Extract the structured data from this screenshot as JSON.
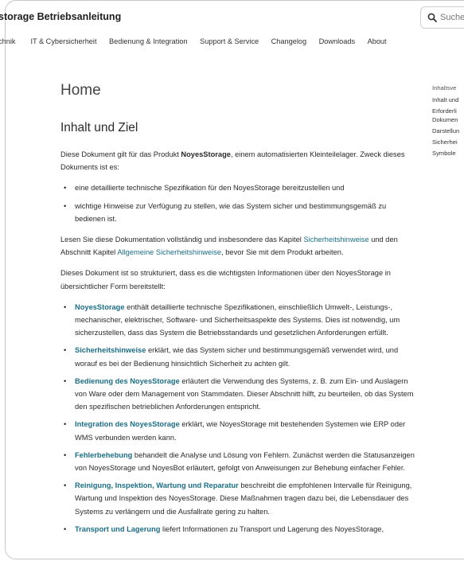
{
  "header": {
    "title": "storage Betriebsanleitung",
    "search_placeholder": "Suche"
  },
  "nav": [
    "chnik",
    "IT & Cybersicherheit",
    "Bedienung & Integration",
    "Support & Service",
    "Changelog",
    "Downloads",
    "About"
  ],
  "page": {
    "title": "Home",
    "section_heading": "Inhalt und Ziel",
    "intro_1": "Diese Dokument gilt für das Produkt ",
    "product": "NoyesStorage",
    "intro_2": ", einem automatisierten Kleinteilelager. Zweck dieses Dokuments ist es:",
    "goals": [
      "eine detaillierte technische Spezifikation für den NoyesStorage bereitzustellen und",
      "wichtige Hinweise zur Verfügung zu stellen, wie das System sicher und bestimmungsgemäß zu bedienen ist."
    ],
    "read_1": "Lesen Sie diese Dokumentation vollständig und insbesondere das Kapitel ",
    "read_link_1": "Sicherheitshinweise",
    "read_2": " und den Abschnitt Kapitel ",
    "read_link_2": "Allgemeine Sicherheitshinweise",
    "read_3": ", bevor Sie mit dem Produkt arbeiten.",
    "structure": "Dieses Dokument ist so strukturiert, dass es die wichtigsten Informationen über den NoyesStorage in übersichtlicher Form bereitstellt:",
    "chapters": [
      {
        "lead": "NoyesStorage",
        "text": " enthält detaillierte technische Spezifikationen, einschließlich Umwelt-, Leistungs-, mechanischer, elektrischer, Software- und Sicherheitsaspekte des Systems. Dies ist notwendig, um sicherzustellen, dass das System die Betriebsstandards und gesetzlichen Anforderungen erfüllt."
      },
      {
        "lead": "Sicherheitshinweise",
        "text": " erklärt, wie das System sicher und bestimmungsgemäß verwendet wird, und worauf es bei der Bedienung hinsichtlich Sicherheit zu achten gilt."
      },
      {
        "lead": "Bedienung des NoyesStorage",
        "text": " erläutert die Verwendung des Systems, z. B. zum Ein- und Auslagern von Ware oder dem Management von Stammdaten. Dieser Abschnitt hilft, zu beurteilen, ob das System den spezifischen betrieblichen Anforderungen entspricht."
      },
      {
        "lead": "Integration des NoyesStorage",
        "text": " erklärt, wie NoyesStorage mit bestehenden Systemen wie ERP oder WMS verbunden werden kann."
      },
      {
        "lead": "Fehlerbehebung",
        "text": " behandelt die Analyse und Lösung von Fehlern. Zunächst werden die Statusanzeigen von NoyesStorage und NoyesBot erläutert, gefolgt von Anweisungen zur Behebung einfacher Fehler."
      },
      {
        "lead": "Reinigung, Inspektion, Wartung und Reparatur",
        "text": " beschreibt die empfohlenen Intervalle für Reinigung, Wartung und Inspektion des NoyesStorage. Diese Maßnahmen tragen dazu bei, die Lebensdauer des Systems zu verlängern und die Ausfallrate gering zu halten."
      },
      {
        "lead": "Transport und Lagerung",
        "text": " liefert Informationen zu Transport und Lagerung des NoyesStorage,"
      }
    ]
  },
  "toc": {
    "heading": "Inhaltsve",
    "items": [
      "Inhalt und",
      "Erforderli\nDokumen",
      "Darstellun",
      "Sicherhei",
      "Symbole"
    ]
  },
  "colors": {
    "link": "#1b6e85",
    "border": "#c9c9c9"
  }
}
